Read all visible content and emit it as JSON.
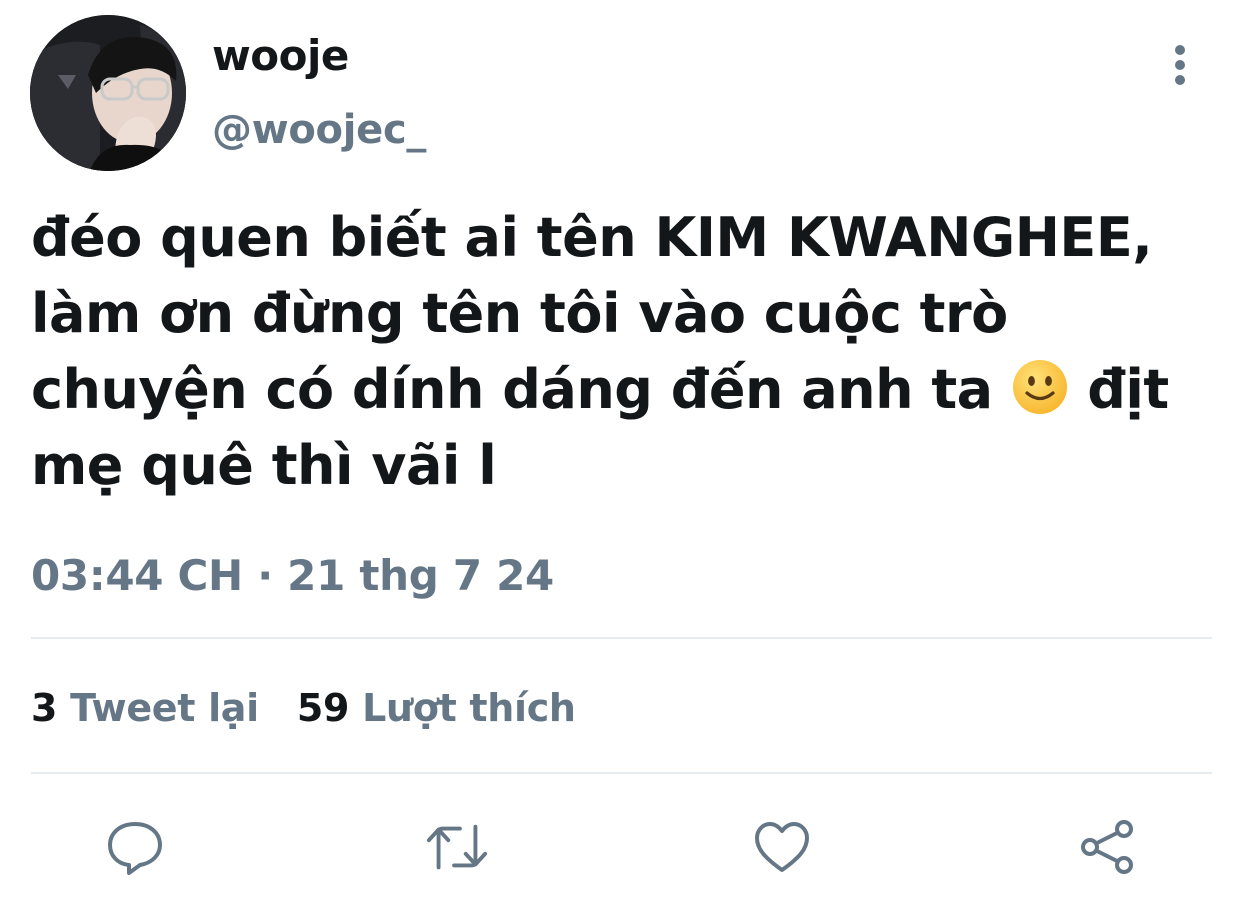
{
  "user": {
    "display_name": "wooje",
    "handle": "@woojec_"
  },
  "tweet": {
    "text_before_emoji": "đéo quen biết ai tên KIM KWANGHEE, làm ơn đừng tên tôi vào cuộc trò chuyện có dính dáng đến anh ta ",
    "emoji": "slightly-smiling-face",
    "text_after_emoji": " địt mẹ quê thì vãi l",
    "timestamp": "03:44 CH · 21 thg 7 24"
  },
  "stats": {
    "retweets_count": "3",
    "retweets_label": "Tweet lại",
    "likes_count": "59",
    "likes_label": "Lượt thích"
  },
  "actions": [
    "reply-icon",
    "retweet-icon",
    "like-icon",
    "share-icon"
  ],
  "colors": {
    "text_primary": "#14171a",
    "text_secondary": "#657786",
    "divider": "#e6ecf0",
    "icon": "#657786",
    "emoji_fill": "#ffcc4d"
  }
}
